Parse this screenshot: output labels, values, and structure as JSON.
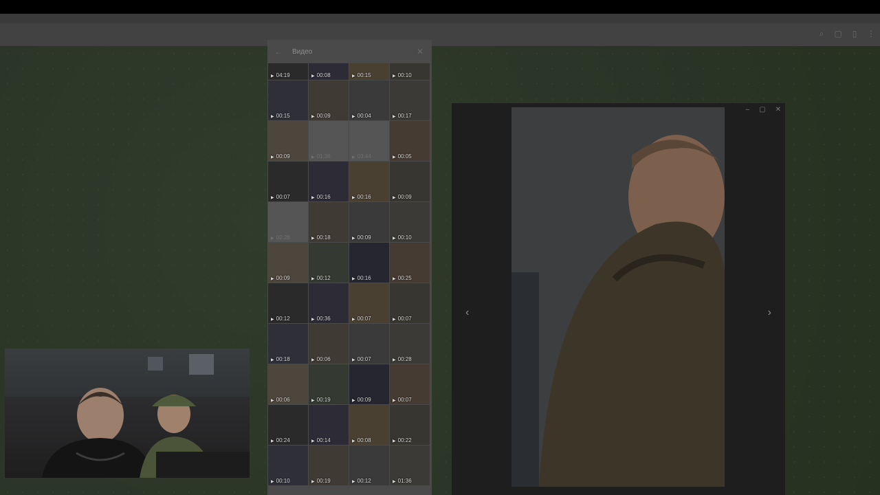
{
  "gallery": {
    "title": "Видео",
    "back_icon": "arrow-left-icon",
    "close_icon": "close-icon",
    "durations": [
      "04:19",
      "00:08",
      "00:15",
      "00:10",
      "00:15",
      "00:09",
      "00:04",
      "00:17",
      "00:09",
      "01:36",
      "03:44",
      "00:05",
      "00:07",
      "00:16",
      "00:16",
      "00:09",
      "02:28",
      "00:18",
      "00:09",
      "00:10",
      "00:09",
      "00:12",
      "00:16",
      "00:25",
      "00:12",
      "00:36",
      "00:07",
      "00:07",
      "00:18",
      "00:06",
      "00:07",
      "00:28",
      "00:06",
      "00:19",
      "00:09",
      "00:07",
      "00:24",
      "00:14",
      "00:08",
      "00:22",
      "00:10",
      "00:19",
      "00:12",
      "01:36"
    ]
  },
  "viewer": {
    "prev_icon": "chevron-left-icon",
    "next_icon": "chevron-right-icon",
    "minimize_icon": "minimize-icon",
    "maximize_icon": "maximize-icon",
    "close_icon": "close-icon"
  }
}
